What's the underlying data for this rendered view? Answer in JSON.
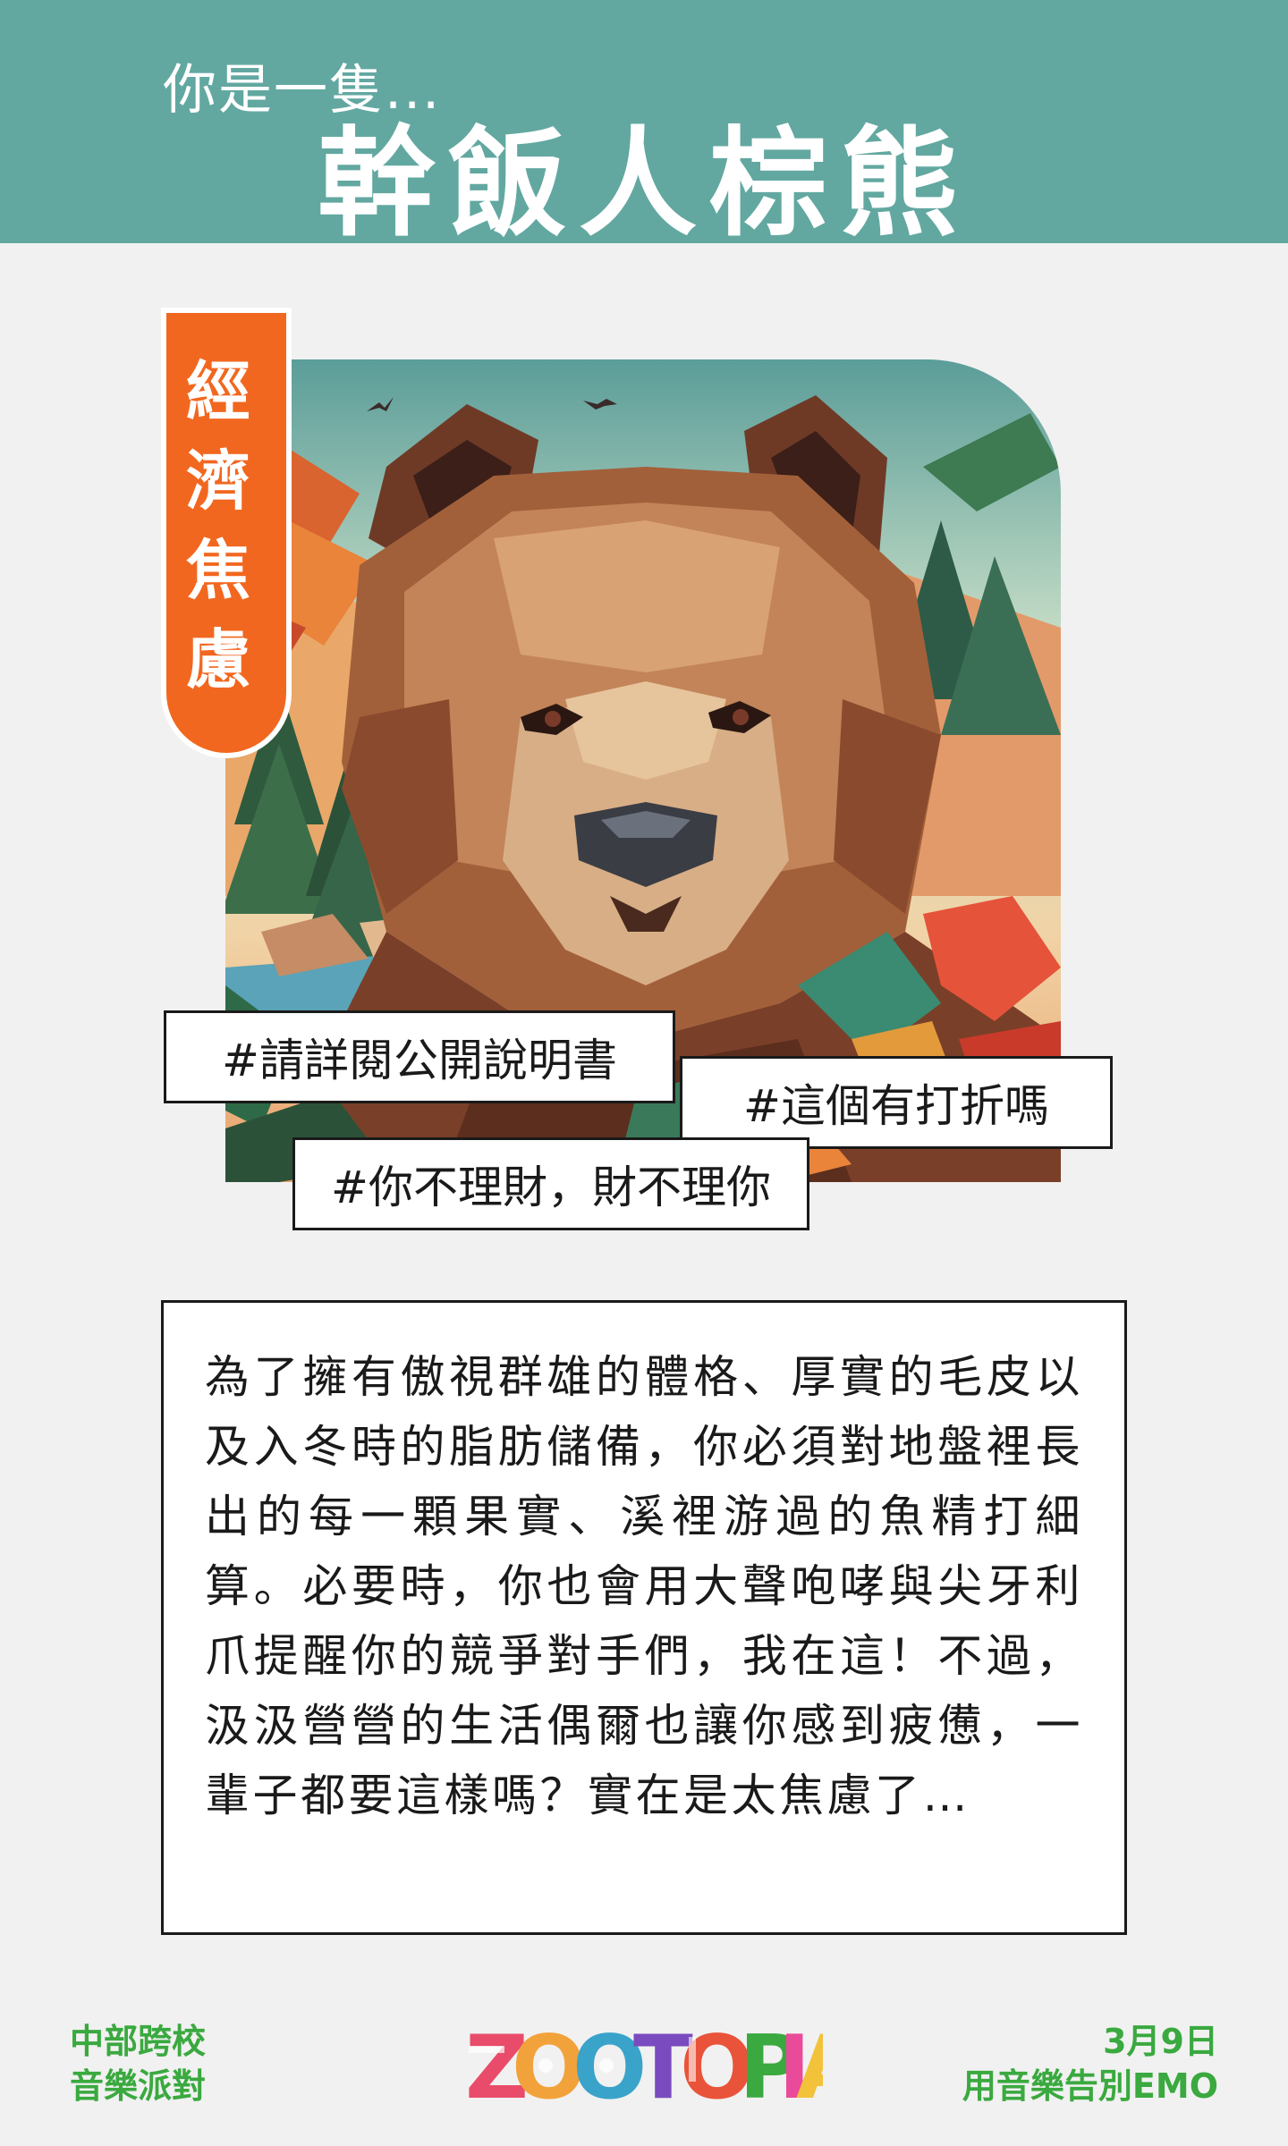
{
  "header": {
    "subtitle": "你是一隻...",
    "title": "幹飯人棕熊"
  },
  "badge": {
    "chars": [
      "經",
      "濟",
      "焦",
      "慮"
    ]
  },
  "hashtags": [
    "#請詳閱公開說明書",
    "#這個有打折嗎",
    "#你不理財，財不理你"
  ],
  "description": "為了擁有傲視群雄的體格、厚實的毛皮以及入冬時的脂肪儲備，你必須對地盤裡長出的每一顆果實、溪裡游過的魚精打細算。必要時，你也會用大聲咆哮與尖牙利爪提醒你的競爭對手們，我在這！不過，汲汲營營的生活偶爾也讓你感到疲憊，一輩子都要這樣嗎？實在是太焦慮了…",
  "footer": {
    "left_line1": "中部跨校",
    "left_line2": "音樂派對",
    "logo_text": "ZOOTOPIA",
    "right_line1": "3月9日",
    "right_line2": "用音樂告別EMO"
  },
  "colors": {
    "header_bg": "#62a8a1",
    "badge_bg": "#f2671f",
    "footer_text": "#3aa93f",
    "page_bg": "#f1f1f1"
  }
}
